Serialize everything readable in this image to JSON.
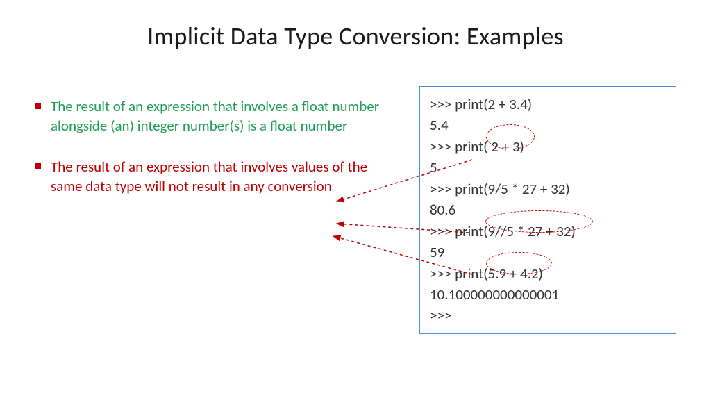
{
  "title": "Implicit Data Type Conversion: Examples",
  "bullets": [
    {
      "text": "The result of an expression that involves a float number alongside (an) integer number(s) is a float number",
      "colorClass": "bullet-green"
    },
    {
      "text": "The result of an expression that involves values of the same data type will not result in any conversion",
      "colorClass": "bullet-red"
    }
  ],
  "code": {
    "lines": [
      ">>> print(2 + 3.4)",
      "5.4",
      ">>> print( 2 + 3)",
      "5",
      ">>> print(9/5 * 27 + 32)",
      "80.6",
      ">>> print(9//5 * 27 + 32)",
      "59",
      ">>> print(5.9 + 4.2)",
      "10.100000000000001",
      ">>>"
    ]
  }
}
